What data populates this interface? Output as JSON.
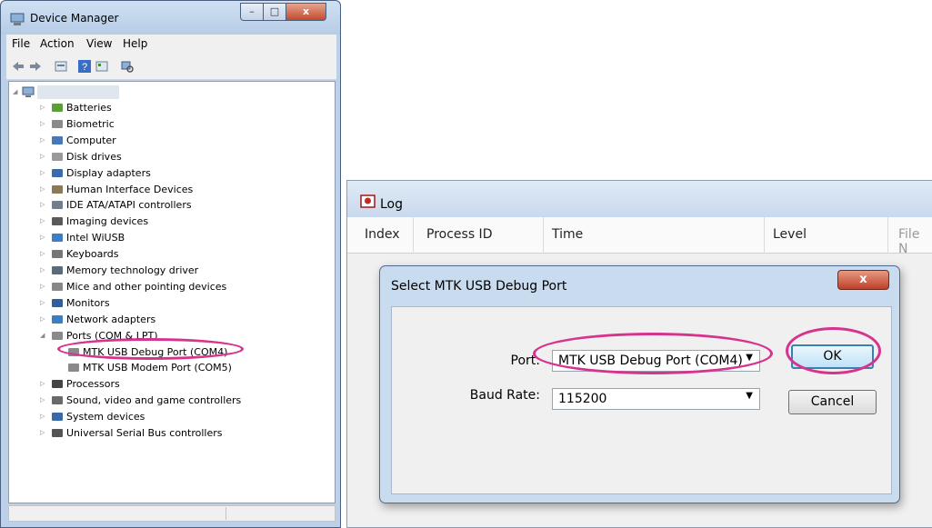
{
  "device_manager": {
    "title": "Device Manager",
    "caption_buttons": {
      "minimize": "–",
      "maximize": "□",
      "close": "x"
    },
    "menu": [
      "File",
      "Action",
      "View",
      "Help"
    ],
    "toolbar_icons": [
      "back-icon",
      "forward-icon",
      "properties-icon",
      "help-icon",
      "update-driver-icon",
      "scan-hardware-icon"
    ],
    "root_label": "",
    "tree_items": [
      {
        "label": "Batteries",
        "icon": "battery-icon"
      },
      {
        "label": "Biometric",
        "icon": "biometric-icon"
      },
      {
        "label": "Computer",
        "icon": "computer-icon"
      },
      {
        "label": "Disk drives",
        "icon": "disk-icon"
      },
      {
        "label": "Display adapters",
        "icon": "display-icon"
      },
      {
        "label": "Human Interface Devices",
        "icon": "hid-icon"
      },
      {
        "label": "IDE ATA/ATAPI controllers",
        "icon": "ide-icon"
      },
      {
        "label": "Imaging devices",
        "icon": "camera-icon"
      },
      {
        "label": "Intel WiUSB",
        "icon": "network-icon"
      },
      {
        "label": "Keyboards",
        "icon": "keyboard-icon"
      },
      {
        "label": "Memory technology driver",
        "icon": "memory-icon"
      },
      {
        "label": "Mice and other pointing devices",
        "icon": "mouse-icon"
      },
      {
        "label": "Monitors",
        "icon": "monitor-icon"
      },
      {
        "label": "Network adapters",
        "icon": "network-icon"
      },
      {
        "label": "Ports (COM & LPT)",
        "icon": "port-icon",
        "expanded": true
      },
      {
        "label": "MTK USB Debug Port (COM4)",
        "icon": "port-icon",
        "child": true
      },
      {
        "label": "MTK USB Modem Port (COM5)",
        "icon": "port-icon",
        "child": true
      },
      {
        "label": "Processors",
        "icon": "processor-icon"
      },
      {
        "label": "Sound, video and game controllers",
        "icon": "sound-icon"
      },
      {
        "label": "System devices",
        "icon": "system-icon"
      },
      {
        "label": "Universal Serial Bus controllers",
        "icon": "usb-icon"
      }
    ]
  },
  "log_window": {
    "title": "Log",
    "columns": [
      "Index",
      "Process ID",
      "Time",
      "Level",
      "File N"
    ]
  },
  "dialog": {
    "title": "Select MTK USB Debug Port",
    "close_label": "x",
    "port_label": "Port:",
    "port_value": "MTK USB Debug Port (COM4)",
    "baud_label": "Baud Rate:",
    "baud_value": "115200",
    "ok_label": "OK",
    "cancel_label": "Cancel"
  },
  "colors": {
    "highlight_ring": "#d6338f",
    "title_bar": "#bcd0e8"
  }
}
